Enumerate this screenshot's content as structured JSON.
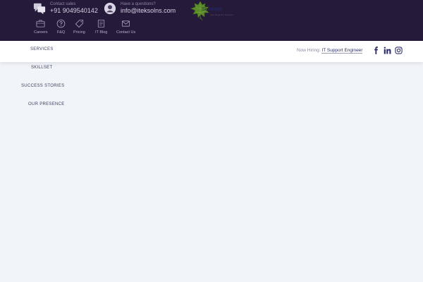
{
  "topbar": {
    "contact_sales": {
      "label": "Contact sales",
      "value": "+91 9049540142",
      "icon": "chat-bubbles-icon"
    },
    "questions": {
      "label": "Have a questions?",
      "value": "info@iteksolns.com",
      "icon": "user-avatar-icon"
    },
    "quicknav": [
      {
        "label": "Careers",
        "icon": "briefcase-icon"
      },
      {
        "label": "F&Q",
        "icon": "question-circle-icon"
      },
      {
        "label": "Pricing",
        "icon": "price-tag-icon"
      },
      {
        "label": "IT Blog",
        "icon": "document-icon"
      },
      {
        "label": "Contact Us",
        "icon": "envelope-icon"
      }
    ]
  },
  "header": {
    "logo": {
      "text": "Solutions",
      "tagline": "Your Need Our Solutions",
      "icon": "leaf-logo-icon"
    },
    "hiring": {
      "label": "Now Hiring:",
      "link": "IT Support Engineer"
    },
    "social": [
      {
        "name": "facebook",
        "icon": "facebook-icon"
      },
      {
        "name": "linkedin",
        "icon": "linkedin-icon"
      },
      {
        "name": "instagram",
        "icon": "instagram-icon"
      }
    ]
  },
  "menu": [
    {
      "label": "SERVICES"
    },
    {
      "label": "SKILLSET"
    },
    {
      "label": "SUCCESS STORIES"
    },
    {
      "label": "OUR PRESENCE"
    }
  ],
  "colors": {
    "topbar_bg": "#261a3a",
    "page_bg": "#f1f4f8",
    "header_bg": "#ffffff",
    "link_color": "#2d2d6e"
  }
}
